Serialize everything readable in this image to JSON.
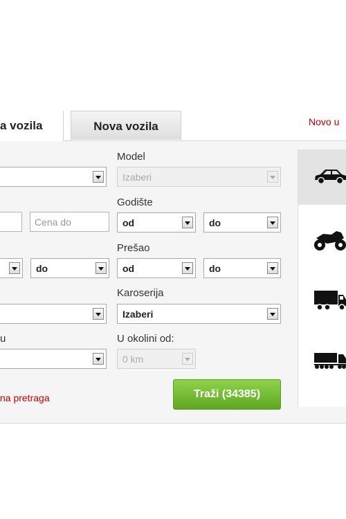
{
  "tabs": {
    "used": "a vozila",
    "new": "Nova vozila"
  },
  "new_link": "Novo u",
  "form": {
    "model_label": "Model",
    "model_value": "Izaberi",
    "godiste_label": "Godište",
    "godiste_from": "od",
    "godiste_to": "do",
    "cena_do_placeholder": "Cena do",
    "presao_label": "Prešao",
    "presao_from": "od",
    "presao_to": "do",
    "row3_left_to": "do",
    "karoserija_label": "Karoserija",
    "karoserija_value": "Izaberi",
    "row5_left_label_tail": "u",
    "okolina_label": "U okolini od:",
    "okolina_value": "0 km"
  },
  "advanced_link": "na pretraga",
  "search_button": "Traži (34385)",
  "vehicle_types": [
    {
      "icon": "car-icon",
      "active": true
    },
    {
      "icon": "motorcycle-icon",
      "active": false
    },
    {
      "icon": "truck-icon",
      "active": false
    },
    {
      "icon": "trailer-truck-icon",
      "active": false
    }
  ]
}
